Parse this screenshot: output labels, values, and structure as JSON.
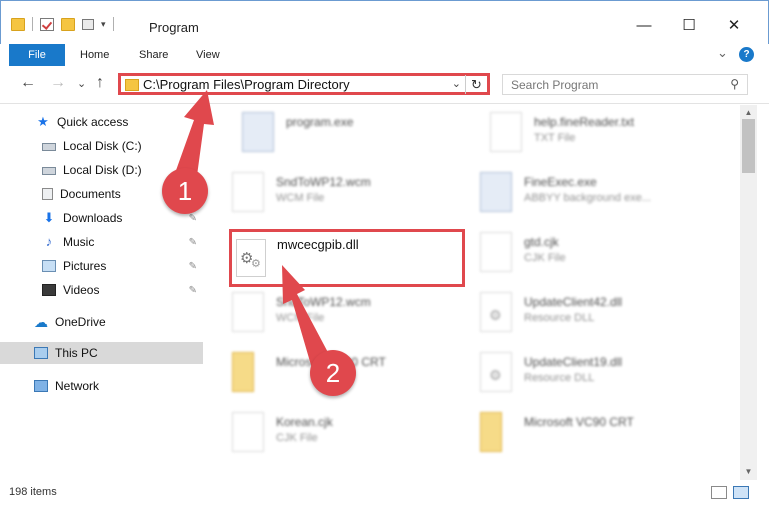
{
  "window": {
    "title": "Program",
    "minimize_glyph": "—",
    "maximize_glyph": "☐",
    "close_glyph": "✕"
  },
  "ribbon": {
    "tabs": [
      "File",
      "Home",
      "Share",
      "View"
    ],
    "expand_glyph": "⌄",
    "help_glyph": "?"
  },
  "address_bar": {
    "path": "C:\\Program Files\\Program Directory",
    "dropdown_glyph": "⌄",
    "refresh_glyph": "↻"
  },
  "search": {
    "placeholder": "Search Program",
    "icon": "search-icon"
  },
  "nav": {
    "back_glyph": "←",
    "forward_glyph": "→",
    "recent_glyph": "⌄",
    "up_glyph": "↑"
  },
  "sidebar": {
    "items": [
      {
        "label": "Quick access",
        "icon": "star-icon"
      },
      {
        "label": "Local Disk (C:)",
        "icon": "disk-icon"
      },
      {
        "label": "Local Disk (D:)",
        "icon": "disk-icon"
      },
      {
        "label": "Documents",
        "icon": "documents-icon"
      },
      {
        "label": "Downloads",
        "icon": "downloads-icon"
      },
      {
        "label": "Music",
        "icon": "music-icon"
      },
      {
        "label": "Pictures",
        "icon": "pictures-icon"
      },
      {
        "label": "Videos",
        "icon": "videos-icon"
      },
      {
        "label": "OneDrive",
        "icon": "onedrive-icon"
      },
      {
        "label": "This PC",
        "icon": "computer-icon"
      },
      {
        "label": "Network",
        "icon": "network-icon"
      }
    ],
    "pin_glyph": "📌"
  },
  "files": [
    {
      "name": "program.exe",
      "type": ""
    },
    {
      "name": "help.fineReader.txt",
      "type": "TXT File"
    },
    {
      "name": "SndToWP12.wcm",
      "type": "WCM File"
    },
    {
      "name": "FineExec.exe",
      "type": "ABBYY background exe..."
    },
    {
      "name": "gtd.cjk",
      "type": "CJK File"
    },
    {
      "name": "SndToWP12.wcm",
      "type": "WCM File"
    },
    {
      "name": "UpdateClient42.dll",
      "type": "Resource DLL"
    },
    {
      "name": "Microsoft VC90 CRT",
      "type": ""
    },
    {
      "name": "UpdateClient19.dll",
      "type": "Resource DLL"
    },
    {
      "name": "Korean.cjk",
      "type": "CJK File"
    },
    {
      "name": "Microsoft VC90 CRT",
      "type": ""
    }
  ],
  "highlighted_file": {
    "name": "mwcecgpib.dll",
    "icon": "dll-file-icon"
  },
  "annotations": {
    "step1": "1",
    "step2": "2"
  },
  "status_bar": {
    "item_count": "198 items"
  },
  "colors": {
    "accent": "#1979ca",
    "annotation_red": "#e0484d"
  }
}
